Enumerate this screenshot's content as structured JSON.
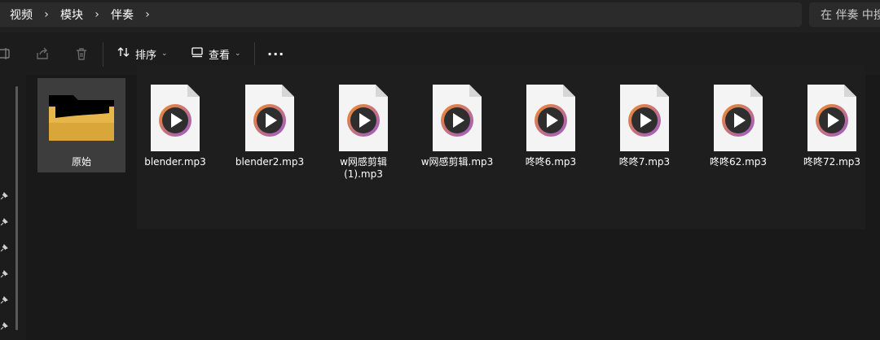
{
  "breadcrumb": {
    "items": [
      "视频",
      "模块",
      "伴奏"
    ]
  },
  "search": {
    "placeholder": "在 伴奏 中搜"
  },
  "toolbar": {
    "sort_label": "排序",
    "view_label": "查看",
    "more_label": "···"
  },
  "files": [
    {
      "name": "原始",
      "type": "folder"
    },
    {
      "name": "blender.mp3",
      "type": "audio"
    },
    {
      "name": "blender2.mp3",
      "type": "audio"
    },
    {
      "name": "w网感剪辑(1).mp3",
      "type": "audio"
    },
    {
      "name": "w网感剪辑.mp3",
      "type": "audio"
    },
    {
      "name": "咚咚6.mp3",
      "type": "audio"
    },
    {
      "name": "咚咚7.mp3",
      "type": "audio"
    },
    {
      "name": "咚咚62.mp3",
      "type": "audio"
    },
    {
      "name": "咚咚72.mp3",
      "type": "audio"
    }
  ],
  "colors": {
    "accent_ring_start": "#f28c28",
    "accent_ring_end": "#9b59d0",
    "folder": "#d9a63a"
  }
}
